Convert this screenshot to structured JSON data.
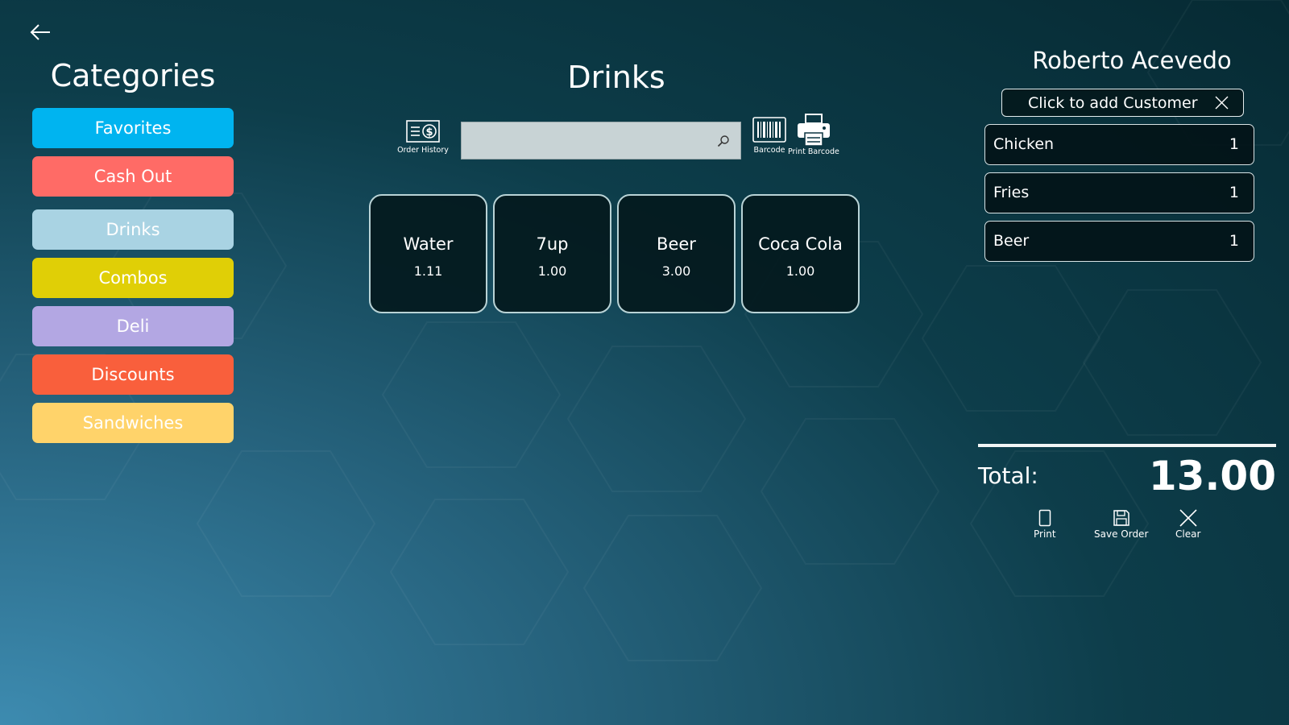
{
  "categories": {
    "title": "Categories",
    "items": [
      {
        "label": "Favorites",
        "color": "#00b4f0"
      },
      {
        "label": "Cash Out",
        "color": "#ff6b66"
      },
      {
        "label": "Drinks",
        "color": "#a9d3e3"
      },
      {
        "label": "Combos",
        "color": "#e0cf06"
      },
      {
        "label": "Deli",
        "color": "#b3a7e3"
      },
      {
        "label": "Discounts",
        "color": "#f95f3c"
      },
      {
        "label": "Sandwiches",
        "color": "#ffd36a"
      }
    ]
  },
  "main": {
    "title": "Drinks",
    "toolbar": {
      "order_history_label": "Order History",
      "barcode_label": "Barcode",
      "print_barcode_label": "Print Barcode"
    },
    "search": {
      "value": "",
      "placeholder": ""
    },
    "products": [
      {
        "name": "Water",
        "price": "1.11"
      },
      {
        "name": "7up",
        "price": "1.00"
      },
      {
        "name": "Beer",
        "price": "3.00"
      },
      {
        "name": "Coca Cola",
        "price": "1.00"
      }
    ]
  },
  "order": {
    "user_name": "Roberto Acevedo",
    "customer_button_label": "Click to add Customer",
    "items": [
      {
        "name": "Chicken",
        "qty": "1"
      },
      {
        "name": "Fries",
        "qty": "1"
      },
      {
        "name": "Beer",
        "qty": "1"
      }
    ],
    "total_label": "Total:",
    "total_value": "13.00",
    "actions": {
      "print_label": "Print",
      "save_label": "Save Order",
      "clear_label": "Clear"
    }
  },
  "icons": {
    "back": "arrow-left-icon",
    "order_history": "money-list-icon",
    "search": "search-icon",
    "barcode": "barcode-icon",
    "print_barcode": "printer-icon",
    "customer_clear": "close-icon",
    "print": "page-icon",
    "save": "floppy-disk-icon",
    "clear": "close-icon"
  }
}
